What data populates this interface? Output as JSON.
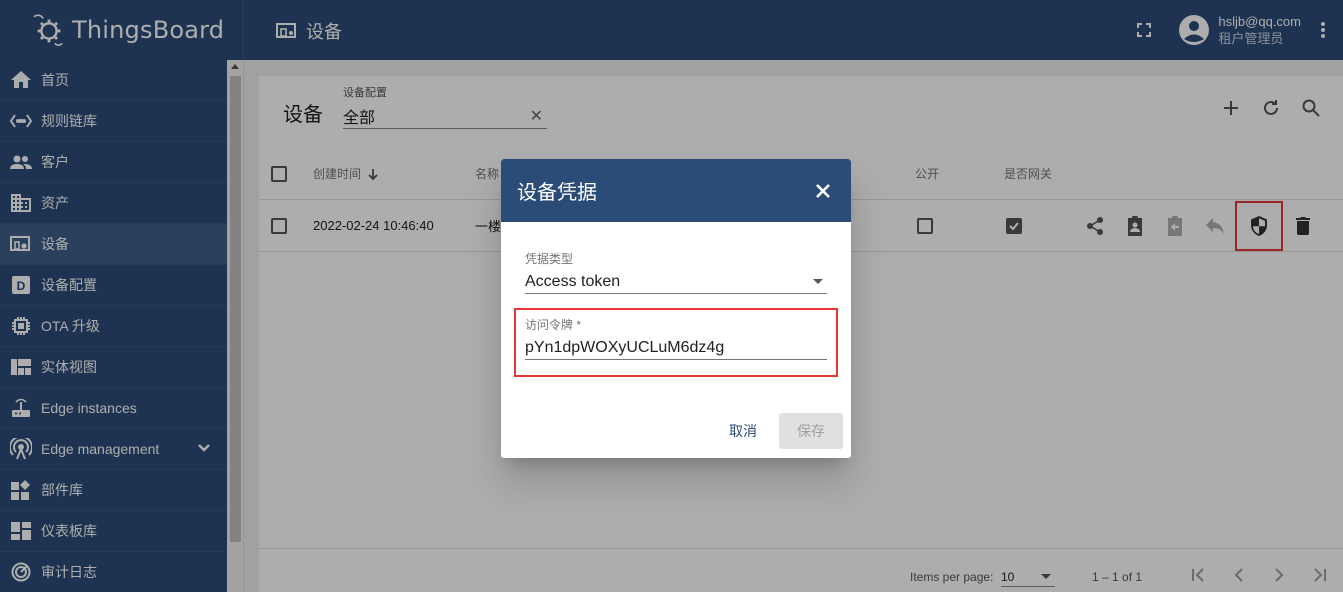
{
  "topbar": {
    "logo_text": "ThingsBoard",
    "page_title": "设备",
    "user_email": "hsljb@qq.com",
    "user_role": "租户管理员"
  },
  "sidebar": {
    "items": [
      {
        "label": "首页",
        "icon": "home-icon"
      },
      {
        "label": "规则链库",
        "icon": "settings-ethernet-icon"
      },
      {
        "label": "客户",
        "icon": "supervisor-account-icon"
      },
      {
        "label": "资产",
        "icon": "domain-icon"
      },
      {
        "label": "设备",
        "icon": "devices-other-icon",
        "active": true
      },
      {
        "label": "设备配置",
        "icon": "device-profile-icon"
      },
      {
        "label": "OTA 升级",
        "icon": "memory-icon"
      },
      {
        "label": "实体视图",
        "icon": "view-quilt-icon"
      },
      {
        "label": "Edge instances",
        "icon": "router-icon"
      },
      {
        "label": "Edge management",
        "icon": "settings-input-antenna-icon"
      },
      {
        "label": "部件库",
        "icon": "widgets-icon"
      },
      {
        "label": "仪表板库",
        "icon": "dashboards-icon"
      },
      {
        "label": "审计日志",
        "icon": "track-changes-icon"
      }
    ]
  },
  "main": {
    "title": "设备",
    "filter_label": "设备配置",
    "filter_value": "全部",
    "columns": {
      "created_time": "创建时间",
      "name": "名称",
      "public": "公开",
      "is_gateway": "是否网关"
    },
    "rows": [
      {
        "created_time": "2022-02-24 10:46:40",
        "name": "一楼",
        "public": false,
        "is_gateway": true
      }
    ],
    "footer": {
      "items_per_page_label": "Items per page:",
      "items_per_page": "10",
      "range": "1 – 1 of 1"
    }
  },
  "dialog": {
    "title": "设备凭据",
    "credential_type_label": "凭据类型",
    "credential_type_value": "Access token",
    "token_label": "访问令牌 *",
    "token_value": "pYn1dpWOXyUCLuM6dz4g",
    "cancel_label": "取消",
    "save_label": "保存"
  },
  "colors": {
    "primary": "#2c4c78",
    "highlight": "#e53935"
  }
}
